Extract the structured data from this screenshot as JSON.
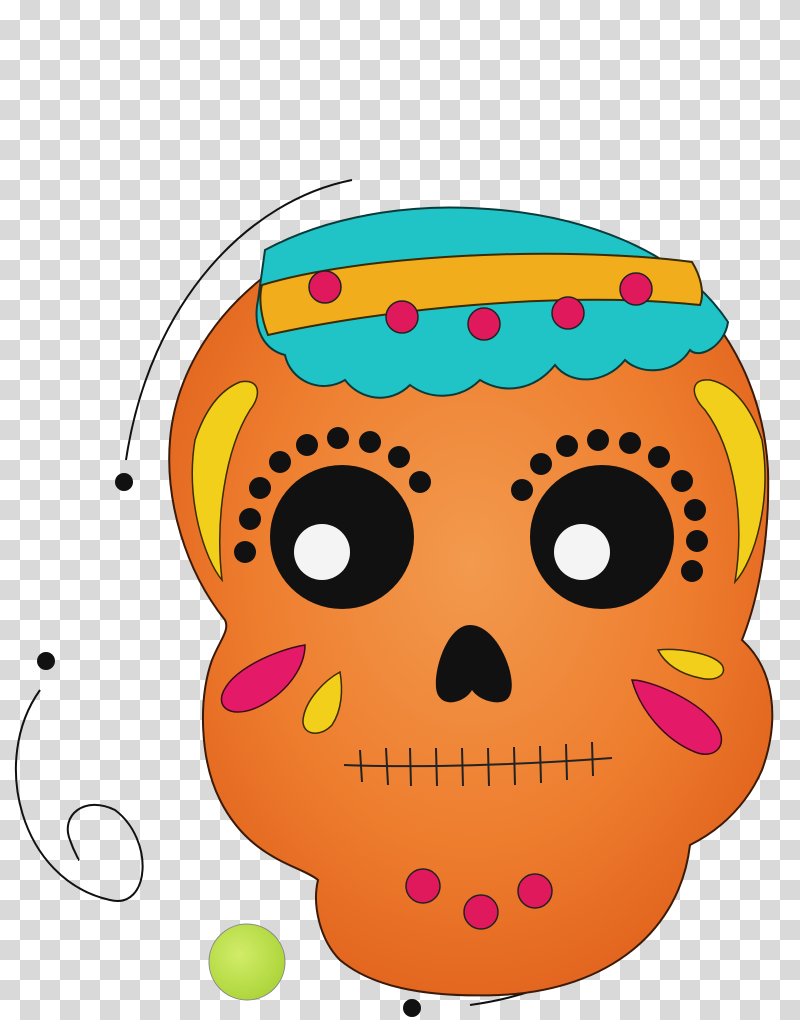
{
  "image": {
    "subject": "sugar-skull",
    "background": "transparency-checkerboard",
    "colors": {
      "skull": "#ee7d2e",
      "skull_shade": "#e0611c",
      "cap": "#20c4c7",
      "band": "#f2ad1c",
      "dots": "#e0185c",
      "eye_outer": "#111111",
      "eye_inner": "#f4f4f4",
      "accent_yellow": "#f2cf1a",
      "accent_pink": "#e41a68",
      "lime": "#b5dc3a",
      "checker_light": "#ffffff",
      "checker_dark": "#d9d9d9"
    }
  }
}
